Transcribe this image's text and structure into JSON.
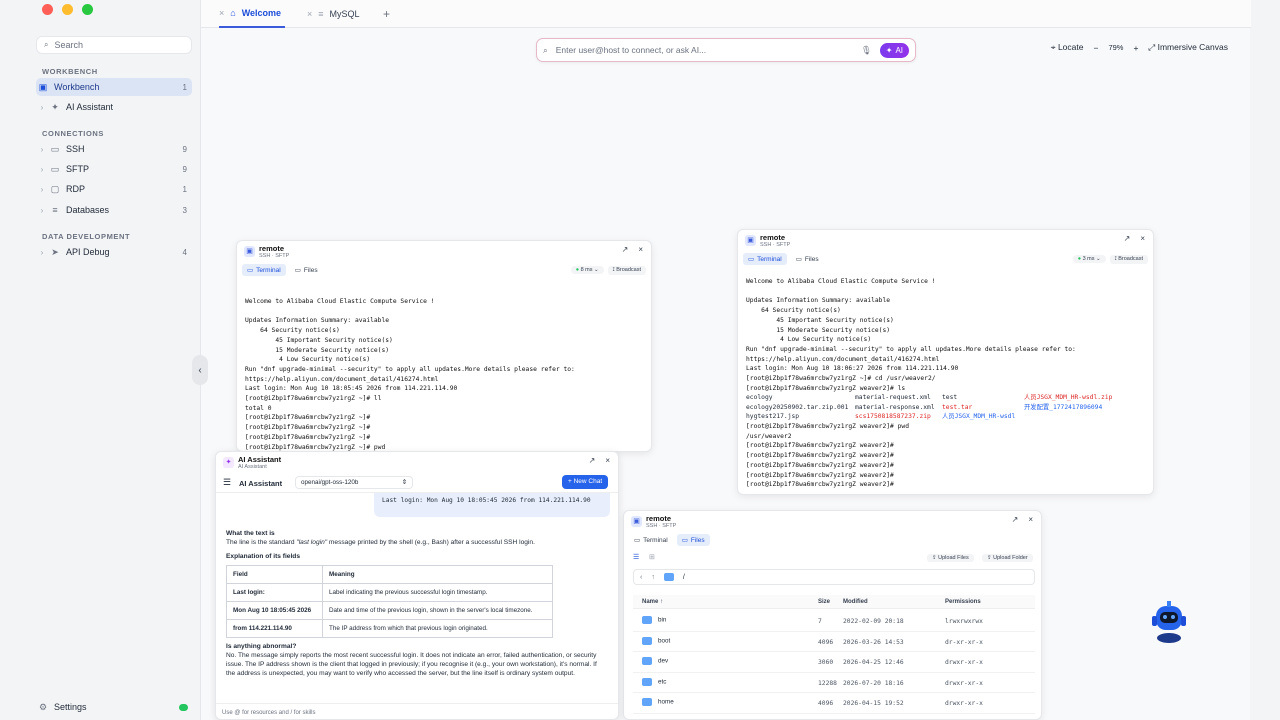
{
  "sidebar": {
    "search_placeholder": "Search",
    "sections": {
      "workbench": "WORKBENCH",
      "connections": "CONNECTIONS",
      "data_development": "DATA DEVELOPMENT"
    },
    "items": [
      {
        "label": "Workbench",
        "count": "1",
        "icon": "window-icon"
      },
      {
        "label": "AI Assistant",
        "count": "",
        "icon": "sparkle-icon"
      },
      {
        "label": "SSH",
        "count": "9",
        "icon": "terminal-icon"
      },
      {
        "label": "SFTP",
        "count": "9",
        "icon": "folder-icon"
      },
      {
        "label": "RDP",
        "count": "1",
        "icon": "monitor-icon"
      },
      {
        "label": "Databases",
        "count": "3",
        "icon": "database-icon"
      },
      {
        "label": "API Debug",
        "count": "4",
        "icon": "send-icon"
      }
    ],
    "settings_label": "Settings"
  },
  "tabs": [
    {
      "label": "Welcome",
      "active": true
    },
    {
      "label": "MySQL",
      "active": false
    }
  ],
  "omnibox": {
    "placeholder": "Enter user@host to connect, or ask AI...",
    "ai_label": "AI"
  },
  "canvas": {
    "locate": "Locate",
    "zoom": "79%",
    "immersive": "Immersive Canvas"
  },
  "win1": {
    "title": "remote",
    "subtitle": "SSH · SFTP",
    "tab_terminal": "Terminal",
    "tab_files": "Files",
    "latency": "8 ms",
    "broadcast": "Broadcast",
    "lines": [
      "Welcome to Alibaba Cloud Elastic Compute Service !",
      "",
      "Updates Information Summary: available",
      "    64 Security notice(s)",
      "        45 Important Security notice(s)",
      "        15 Moderate Security notice(s)",
      "         4 Low Security notice(s)",
      "Run \"dnf upgrade-minimal --security\" to apply all updates.More details please refer to:",
      "https://help.aliyun.com/document_detail/416274.html",
      "Last login: Mon Aug 10 18:05:45 2026 from 114.221.114.90",
      "[root@iZbp1f78wa6mrcbw7yz1rgZ ~]# ll",
      "total 0",
      "[root@iZbp1f78wa6mrcbw7yz1rgZ ~]#",
      "[root@iZbp1f78wa6mrcbw7yz1rgZ ~]#",
      "[root@iZbp1f78wa6mrcbw7yz1rgZ ~]#",
      "[root@iZbp1f78wa6mrcbw7yz1rgZ ~]# pwd"
    ]
  },
  "win2": {
    "title": "remote",
    "subtitle": "SSH · SFTP",
    "tab_terminal": "Terminal",
    "tab_files": "Files",
    "latency": "3 ms",
    "broadcast": "Broadcast",
    "lines": [
      "Welcome to Alibaba Cloud Elastic Compute Service !",
      "",
      "Updates Information Summary: available",
      "    64 Security notice(s)",
      "        45 Important Security notice(s)",
      "        15 Moderate Security notice(s)",
      "         4 Low Security notice(s)",
      "Run \"dnf upgrade-minimal --security\" to apply all updates.More details please refer to:",
      "https://help.aliyun.com/document_detail/416274.html",
      "Last login: Mon Aug 10 18:06:27 2026 from 114.221.114.90",
      "[root@iZbp1f78wa6mrcbw7yz1rgZ ~]# cd /usr/weaver2/",
      "[root@iZbp1f78wa6mrcbw7yz1rgZ weaver2]# ls"
    ],
    "ls": {
      "col1": [
        "ecology",
        "ecology20250902.tar.zip.001",
        "hygtest217.jsp"
      ],
      "col2": [
        "material-request.xml",
        "material-response.xml",
        "scs1750818587237.zip"
      ],
      "col3": [
        "test",
        "test.tar",
        "人员JSGX_MDM_HR-wsdl"
      ],
      "col4": [
        "人员JSGX_MDM_HR-wsdl.zip",
        "开发配置_1772417896094",
        ""
      ]
    },
    "lines_after": [
      "[root@iZbp1f78wa6mrcbw7yz1rgZ weaver2]# pwd",
      "/usr/weaver2",
      "[root@iZbp1f78wa6mrcbw7yz1rgZ weaver2]#",
      "[root@iZbp1f78wa6mrcbw7yz1rgZ weaver2]#",
      "[root@iZbp1f78wa6mrcbw7yz1rgZ weaver2]#",
      "[root@iZbp1f78wa6mrcbw7yz1rgZ weaver2]#",
      "[root@iZbp1f78wa6mrcbw7yz1rgZ weaver2]# "
    ]
  },
  "ai": {
    "title": "AI Assistant",
    "subtitle": "AI Assistant",
    "header_label": "AI Assistant",
    "model": "openai/gpt-oss-120b",
    "new_chat": "+ New Chat",
    "user_bubble": "Last login: Mon Aug 10 18:05:45 2026 from 114.221.114.90",
    "h1": "What the text is",
    "p1_a": "The line is the standard ",
    "p1_em": "\"last login\"",
    "p1_b": " message printed by the shell (e.g., Bash) after a successful SSH login.",
    "h2": "Explanation of its fields",
    "table_head": [
      "Field",
      "Meaning"
    ],
    "table_rows": [
      [
        "Last login:",
        "Label indicating the previous successful login timestamp."
      ],
      [
        "Mon Aug 10 18:05:45 2026",
        "Date and time of the previous login, shown in the server's local timezone."
      ],
      [
        "from 114.221.114.90",
        "The IP address from which that previous login originated."
      ]
    ],
    "h3": "Is anything abnormal?",
    "p2": "No. The message simply reports the most recent successful login. It does not indicate an error, failed authentication, or security issue. The IP address shown is the client that logged in previously; if you recognise it (e.g., your own workstation), it's normal. If the address is unexpected, you may want to verify who accessed the server, but the line itself is ordinary system output.",
    "input_hint": "Use @ for resources and / for skills"
  },
  "win3": {
    "title": "remote",
    "subtitle": "SSH · SFTP",
    "tab_terminal": "Terminal",
    "tab_files": "Files",
    "upload_files": "Upload Files",
    "upload_folder": "Upload Folder",
    "path": "/",
    "columns": [
      "Name",
      "Size",
      "Modified",
      "Permissions"
    ],
    "files": [
      {
        "name": "bin",
        "size": "7",
        "modified": "2022-02-09 20:18",
        "perm": "lrwxrwxrwx"
      },
      {
        "name": "boot",
        "size": "4096",
        "modified": "2026-03-26 14:53",
        "perm": "dr-xr-xr-x"
      },
      {
        "name": "dev",
        "size": "3060",
        "modified": "2026-04-25 12:46",
        "perm": "drwxr-xr-x"
      },
      {
        "name": "etc",
        "size": "12288",
        "modified": "2026-07-20 18:16",
        "perm": "drwxr-xr-x"
      },
      {
        "name": "home",
        "size": "4096",
        "modified": "2026-04-15 19:52",
        "perm": "drwxr-xr-x"
      }
    ]
  },
  "colors": {
    "accent": "#3b5bdb",
    "ai_gradient": "#7c3aed",
    "new_chat": "#2563eb",
    "red": "#dc2626"
  }
}
